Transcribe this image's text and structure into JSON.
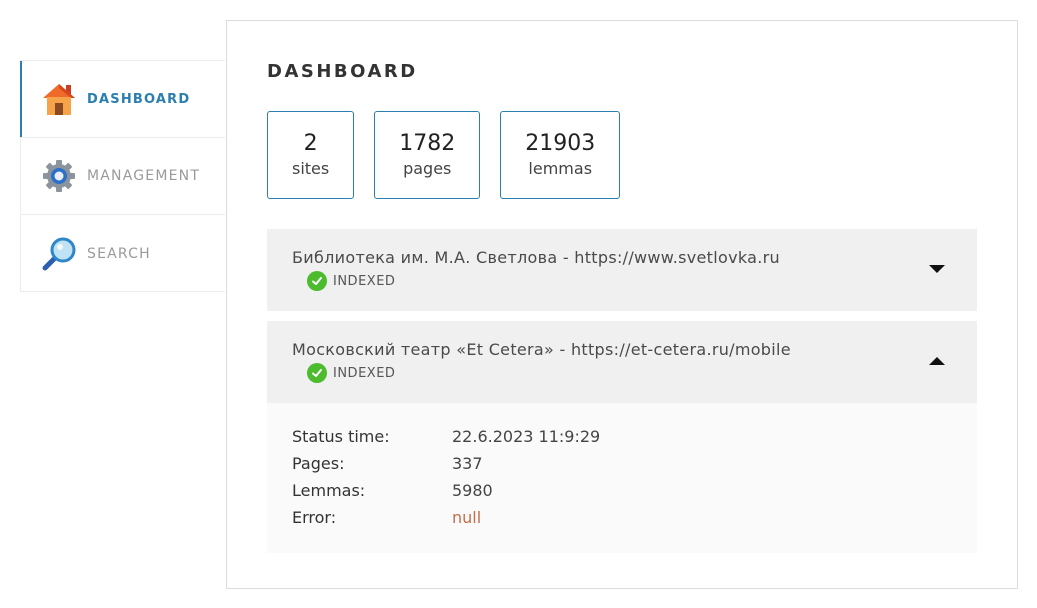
{
  "sidebar": {
    "items": [
      {
        "label": "DASHBOARD",
        "icon": "home-icon",
        "active": true
      },
      {
        "label": "MANAGEMENT",
        "icon": "gear-icon",
        "active": false
      },
      {
        "label": "SEARCH",
        "icon": "magnifier-icon",
        "active": false
      }
    ]
  },
  "main": {
    "title": "DASHBOARD",
    "stats": [
      {
        "value": "2",
        "label": "sites"
      },
      {
        "value": "1782",
        "label": "pages"
      },
      {
        "value": "21903",
        "label": "lemmas"
      }
    ],
    "sites": [
      {
        "name": "Библиотека им. М.А. Светлова - https://www.svetlovka.ru",
        "status": "INDEXED",
        "expanded": false
      },
      {
        "name": "Московский театр «Et Cetera» - https://et-cetera.ru/mobile",
        "status": "INDEXED",
        "expanded": true,
        "details": [
          {
            "key": "Status time:",
            "value": "22.6.2023 11:9:29"
          },
          {
            "key": "Pages:",
            "value": "337"
          },
          {
            "key": "Lemmas:",
            "value": "5980"
          },
          {
            "key": "Error:",
            "value": "null"
          }
        ]
      }
    ]
  },
  "colors": {
    "accent": "#2a7fb0",
    "indexed": "#4cbb2d",
    "error": "#c0704a"
  }
}
